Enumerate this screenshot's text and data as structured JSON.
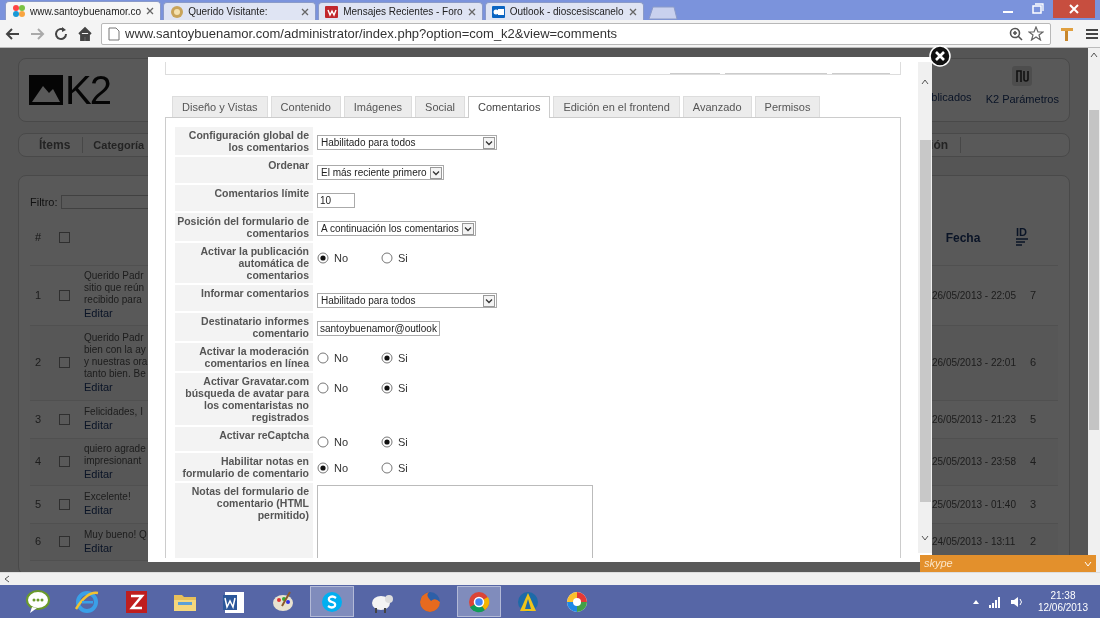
{
  "browser": {
    "tabs": [
      {
        "title": "www.santoybuenamor.co",
        "kind": "flower",
        "selected": true
      },
      {
        "title": "Querido Visitante:",
        "kind": "circle",
        "selected": false
      },
      {
        "title": "Mensajes Recientes - Foro",
        "kind": "red-tile",
        "selected": false
      },
      {
        "title": "Outlook - dioscesiscanelo",
        "kind": "blue-tile",
        "selected": false
      }
    ],
    "address": "www.santoybuenamor.com/administrator/index.php?option=com_k2&view=comments"
  },
  "page": {
    "logo": "K2",
    "toolbar": [
      "blicados",
      "K2 Parámetros"
    ],
    "nav": [
      "Ítems",
      "Categoría",
      "ión"
    ],
    "filter_label": "Filtro:",
    "table": {
      "columns": [
        "#",
        "Fecha",
        "ID"
      ],
      "select_all_checked": false,
      "rows": [
        {
          "number": "1",
          "lines": [
            "Querido Padr",
            "sitio que reún",
            "recibido para"
          ],
          "edit": "Editar",
          "date": "26/05/2013 - 22:05",
          "id": "7",
          "checked": false
        },
        {
          "number": "2",
          "lines": [
            "Querido Padr",
            "bien con la ay",
            "y nuestras ora",
            "tanto bien. Be"
          ],
          "edit": "Editar",
          "date": "26/05/2013 - 22:01",
          "id": "6",
          "checked": false
        },
        {
          "number": "3",
          "lines": [
            "Felicidades, I"
          ],
          "edit": "Editar",
          "date": "26/05/2013 - 21:23",
          "id": "5",
          "checked": false
        },
        {
          "number": "4",
          "lines": [
            "quiero agrade",
            "impresionant"
          ],
          "edit": "Editar",
          "date": "25/05/2013 - 23:58",
          "id": "4",
          "checked": false
        },
        {
          "number": "5",
          "lines": [
            "Excelente!"
          ],
          "edit": "Editar",
          "date": "25/05/2013 - 01:40",
          "id": "3",
          "checked": false
        },
        {
          "number": "6",
          "lines": [
            "Muy bueno! Q"
          ],
          "edit": "Editar",
          "date": "24/05/2013 - 13:11",
          "id": "2",
          "checked": false
        }
      ]
    }
  },
  "modal": {
    "tabs": [
      {
        "label": "Diseño y Vistas",
        "selected": false
      },
      {
        "label": "Contenido",
        "selected": false
      },
      {
        "label": "Imágenes",
        "selected": false
      },
      {
        "label": "Social",
        "selected": false
      },
      {
        "label": "Comentarios",
        "selected": true
      },
      {
        "label": "Edición en el frontend",
        "selected": false
      },
      {
        "label": "Avanzado",
        "selected": false
      },
      {
        "label": "Permisos",
        "selected": false
      }
    ],
    "fields": [
      {
        "kind": "select",
        "label": "Configuración global de los comentarios",
        "value": "Habilitado para todos",
        "wide": true
      },
      {
        "kind": "select",
        "label": "Ordenar",
        "value": "El más reciente primero",
        "wide": false
      },
      {
        "kind": "text",
        "label": "Comentarios límite",
        "value": "10"
      },
      {
        "kind": "select",
        "label": "Posición del formulario de comentarios",
        "value": "A continuación los comentarios",
        "wide": false
      },
      {
        "kind": "radio",
        "label": "Activar la publicación automática de comentarios",
        "options": [
          {
            "label": "No",
            "selected": true
          },
          {
            "label": "Si",
            "selected": false
          }
        ]
      },
      {
        "kind": "select",
        "label": "Informar comentarios",
        "value": "Habilitado para todos",
        "wide": true
      },
      {
        "kind": "text",
        "label": "Destinatario informes comentario",
        "value": "santoybuenamor@outlook"
      },
      {
        "kind": "radio",
        "label": "Activar la moderación comentarios en línea",
        "options": [
          {
            "label": "No",
            "selected": false
          },
          {
            "label": "Si",
            "selected": true
          }
        ]
      },
      {
        "kind": "radio",
        "label": "Activar Gravatar.com búsqueda de avatar para los comentaristas no registrados",
        "options": [
          {
            "label": "No",
            "selected": false
          },
          {
            "label": "Si",
            "selected": true
          }
        ]
      },
      {
        "kind": "radio",
        "label": "Activar reCaptcha",
        "options": [
          {
            "label": "No",
            "selected": false
          },
          {
            "label": "Si",
            "selected": true
          }
        ]
      },
      {
        "kind": "radio",
        "label": "Habilitar notas en formulario de comentario",
        "options": [
          {
            "label": "No",
            "selected": true
          },
          {
            "label": "Si",
            "selected": false
          }
        ]
      },
      {
        "kind": "textarea",
        "label": "Notas del formulario de comentario (HTML permitido)"
      }
    ]
  },
  "skype_bar": {
    "label": "skype"
  },
  "taskbar": {
    "apps": [
      {
        "kind": "talk",
        "active": false
      },
      {
        "kind": "ie",
        "active": false
      },
      {
        "kind": "filezilla",
        "active": false
      },
      {
        "kind": "folder",
        "active": false
      },
      {
        "kind": "word",
        "active": false
      },
      {
        "kind": "paint",
        "active": false
      },
      {
        "kind": "skype",
        "active": true
      },
      {
        "kind": "sheep",
        "active": false
      },
      {
        "kind": "firefox",
        "active": false
      },
      {
        "kind": "chrome",
        "active": true
      },
      {
        "kind": "avast",
        "active": false
      },
      {
        "kind": "picasa",
        "active": false
      }
    ],
    "time": "21:38",
    "date": "12/06/2013"
  }
}
